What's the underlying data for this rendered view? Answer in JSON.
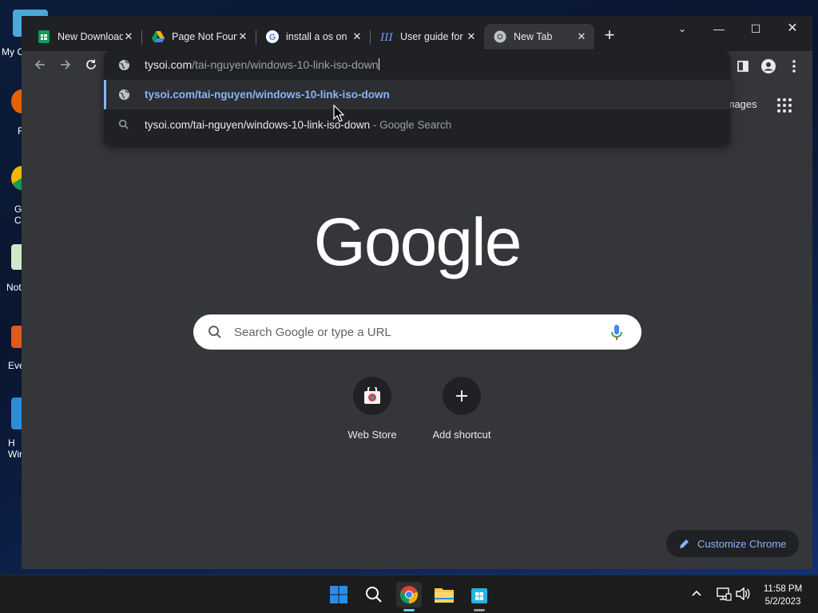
{
  "desktop": {
    "icons": [
      {
        "label": "My C"
      },
      {
        "label": "F"
      },
      {
        "label": "G\nCh"
      },
      {
        "label": "Not"
      },
      {
        "label": "Eve"
      },
      {
        "label": "H\nWin"
      }
    ]
  },
  "tabs": [
    {
      "title": "New Downloads",
      "icon": "sheets-icon"
    },
    {
      "title": "Page Not Found",
      "icon": "drive-icon"
    },
    {
      "title": "install a os on",
      "icon": "google-icon"
    },
    {
      "title": "User guide for",
      "icon": "site-icon"
    },
    {
      "title": "New Tab",
      "icon": "chrome-icon"
    }
  ],
  "omnibox": {
    "input_domain": "tysoi.com",
    "input_path": "/tai-nguyen/windows-10-link-iso-down",
    "suggestions": [
      {
        "text": "tysoi.com/tai-nguyen/windows-10-link-iso-down",
        "suffix": ""
      },
      {
        "text": "tysoi.com/tai-nguyen/windows-10-link-iso-down",
        "suffix": " - Google Search"
      }
    ]
  },
  "ntp": {
    "images_link": "Images",
    "search_placeholder": "Search Google or type a URL",
    "shortcuts": [
      {
        "label": "Web Store"
      },
      {
        "label": "Add shortcut"
      }
    ],
    "customize_label": "Customize Chrome"
  },
  "taskbar": {
    "time": "11:58 PM",
    "date": "5/2/2023"
  },
  "colors": {
    "accent": "#8ab4f8",
    "ntp_bg": "#35363a",
    "tabstrip_bg": "#202124"
  }
}
